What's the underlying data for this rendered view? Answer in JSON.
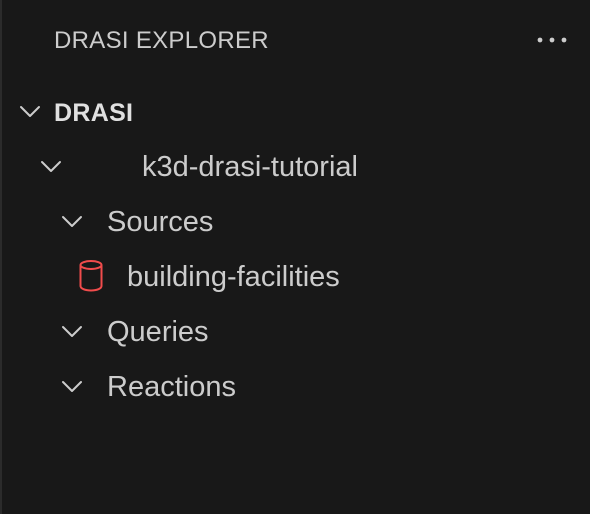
{
  "panel": {
    "title": "DRASI EXPLORER",
    "more_actions_icon": "ellipsis-icon"
  },
  "tree": {
    "root": {
      "label": "DRASI",
      "icon": "chevron-down-icon"
    },
    "cluster": {
      "label": "k3d-drasi-tutorial",
      "icon": "chevron-down-icon"
    },
    "sources": {
      "label": "Sources",
      "icon": "chevron-down-icon"
    },
    "source_item": {
      "label": "building-facilities",
      "icon": "database-icon"
    },
    "queries": {
      "label": "Queries",
      "icon": "chevron-down-icon"
    },
    "reactions": {
      "label": "Reactions",
      "icon": "chevron-down-icon"
    }
  },
  "colors": {
    "background": "#181818",
    "text": "#cccccc",
    "database_icon": "#f14c4c"
  }
}
